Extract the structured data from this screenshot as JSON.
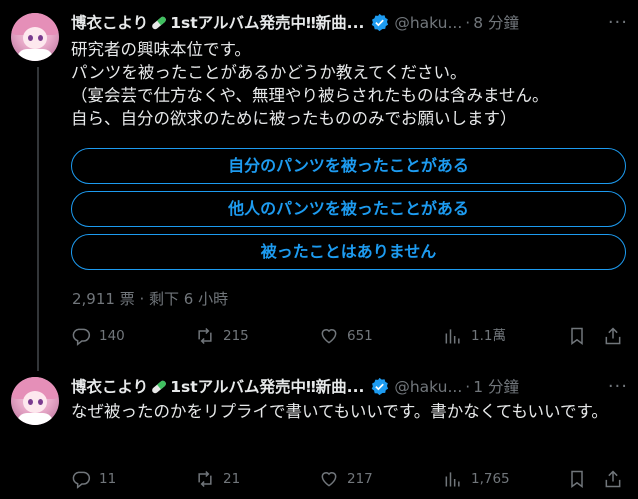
{
  "post1": {
    "author_name": "博衣こより💊1stアルバム発売中‼新曲...",
    "author_name_a": "博衣こより",
    "author_name_b": "1stアルバム発売中‼新曲...",
    "handle": "@haku...",
    "dot": "·",
    "time": "8 分鐘",
    "more": "···",
    "text": "研究者の興味本位です。\nパンツを被ったことがあるかどうか教えてください。\n（宴会芸で仕方なくや、無理やり被らされたものは含みません。\n自ら、自分の欲求のために被ったもののみでお願いします）",
    "poll": {
      "options": [
        "自分のパンツを被ったことがある",
        "他人のパンツを被ったことがある",
        "被ったことはありません"
      ],
      "meta": "2,911 票 · 剩下 6 小時"
    },
    "actions": {
      "replies": "140",
      "reposts": "215",
      "likes": "651",
      "views": "1.1萬"
    }
  },
  "post2": {
    "author_name_a": "博衣こより",
    "author_name_b": "1stアルバム発売中‼新曲...",
    "handle": "@haku...",
    "dot": "·",
    "time": "1 分鐘",
    "more": "···",
    "text": "なぜ被ったのかをリプライで書いてもいいです。書かなくてもいいです。",
    "actions": {
      "replies": "11",
      "reposts": "21",
      "likes": "217",
      "views": "1,765"
    }
  },
  "colors": {
    "accent": "#1d9bf0",
    "muted": "#71767b",
    "text": "#e7e9ea",
    "background": "#000000"
  },
  "icons": [
    "pill-emoji-icon",
    "verified-badge-icon",
    "reply-icon",
    "repost-icon",
    "like-icon",
    "views-icon",
    "bookmark-icon",
    "share-icon",
    "more-icon"
  ]
}
